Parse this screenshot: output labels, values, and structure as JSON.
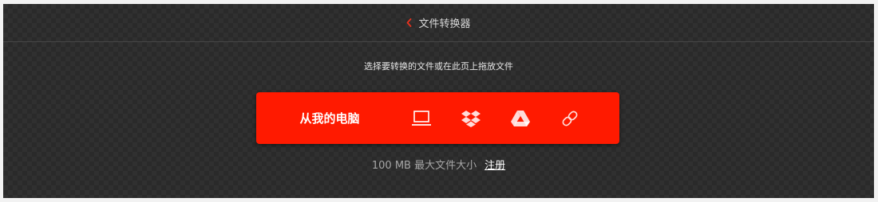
{
  "header": {
    "back_icon": "chevron-left-icon",
    "title": "文件转换器",
    "accent_color": "#e8321e"
  },
  "instructions": "选择要转换的文件或在此页上拖放文件",
  "upload": {
    "from_computer_label": "从我的电脑",
    "background_color": "#ff1a00",
    "sources": [
      {
        "name": "device",
        "icon": "laptop-icon"
      },
      {
        "name": "dropbox",
        "icon": "dropbox-icon"
      },
      {
        "name": "google-drive",
        "icon": "google-drive-icon"
      },
      {
        "name": "url",
        "icon": "link-icon"
      }
    ]
  },
  "footer": {
    "size_limit": "100 MB 最大文件大小",
    "signup_link": "注册"
  }
}
